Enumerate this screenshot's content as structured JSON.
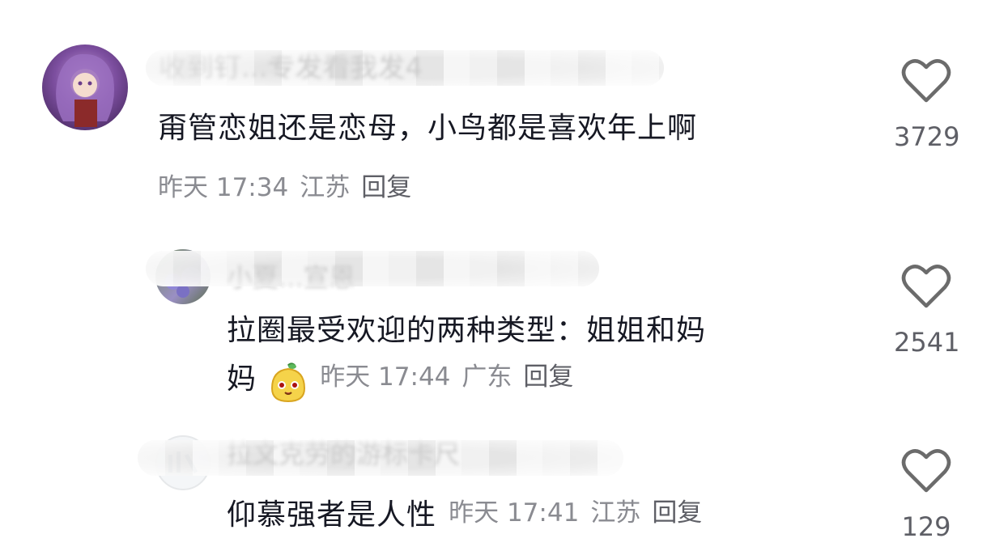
{
  "comments": [
    {
      "author": "收到钉...专发看我发4",
      "text": "甭管恋姐还是恋母，小鸟都是喜欢年上啊",
      "time": "昨天 17:34",
      "location": "江苏",
      "reply_label": "回复",
      "likes": "3729"
    },
    {
      "author": "小夏...宣恩",
      "text_line1": "拉圈最受欢迎的两种类型：姐姐和妈",
      "text_line2": "妈",
      "emoji": "pear-face-emoji",
      "time": "昨天 17:44",
      "location": "广东",
      "reply_label": "回复",
      "likes": "2541"
    },
    {
      "author": "拉文克劳的游标卡尺",
      "text": "仰慕强者是人性",
      "time": "昨天 17:41",
      "location": "江苏",
      "reply_label": "回复",
      "likes": "129"
    }
  ],
  "icons": {
    "like": "heart-outline-icon"
  },
  "colors": {
    "text": "#161823",
    "meta": "#8a8b91",
    "reply": "#5e5f66",
    "icon": "#6b6b6b"
  }
}
